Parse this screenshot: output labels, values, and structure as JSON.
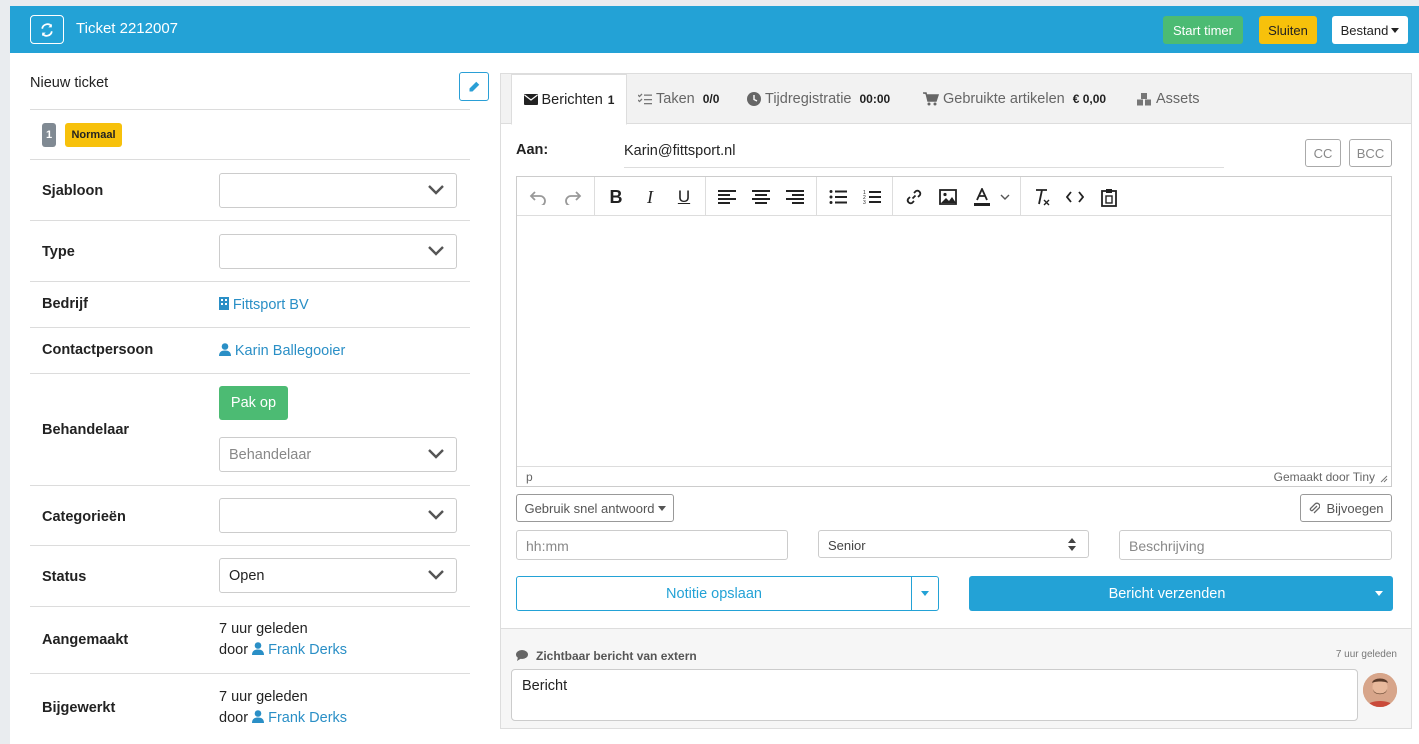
{
  "header": {
    "title": "Ticket 2212007",
    "start_timer": "Start timer",
    "sluiten": "Sluiten",
    "bestand": "Bestand"
  },
  "left": {
    "title": "Nieuw ticket",
    "priority_number": "1",
    "priority_label": "Normaal",
    "sjabloon_label": "Sjabloon",
    "type_label": "Type",
    "bedrijf_label": "Bedrijf",
    "bedrijf_value": "Fittsport BV",
    "contact_label": "Contactpersoon",
    "contact_value": "Karin Ballegooier",
    "behandelaar_label": "Behandelaar",
    "pakop": "Pak op",
    "behandelaar_placeholder": "Behandelaar",
    "categorieen_label": "Categorieën",
    "status_label": "Status",
    "status_value": "Open",
    "aangemaakt_label": "Aangemaakt",
    "aangemaakt_time": "7 uur geleden",
    "aangemaakt_door": "door",
    "aangemaakt_user": "Frank Derks",
    "bijgewerkt_label": "Bijgewerkt",
    "bijgewerkt_time": "7 uur geleden",
    "bijgewerkt_door": "door",
    "bijgewerkt_user": "Frank Derks"
  },
  "tabs": {
    "berichten": "Berichten",
    "berichten_count": "1",
    "taken": "Taken",
    "taken_count": "0/0",
    "tijd": "Tijdregistratie",
    "tijd_value": "00:00",
    "artikelen": "Gebruikte artikelen",
    "artikelen_value": "€ 0,00",
    "assets": "Assets"
  },
  "compose": {
    "aan_label": "Aan:",
    "aan_value": "Karin@fittsport.nl",
    "cc": "CC",
    "bcc": "BCC",
    "status_path": "p",
    "tiny_credit": "Gemaakt door Tiny",
    "snel_antwoord": "Gebruik snel antwoord",
    "bijvoegen": "Bijvoegen",
    "time_placeholder": "hh:mm",
    "level_value": "Senior",
    "beschrijving_placeholder": "Beschrijving",
    "notitie": "Notitie opslaan",
    "verzenden": "Bericht verzenden"
  },
  "message": {
    "heading": "Zichtbaar bericht van extern",
    "time": "7 uur geleden",
    "body": "Bericht"
  },
  "colors": {
    "header": "#23a2d6",
    "green": "#4cbb73",
    "yellow": "#f7c10b",
    "link": "#2a8fc6"
  }
}
